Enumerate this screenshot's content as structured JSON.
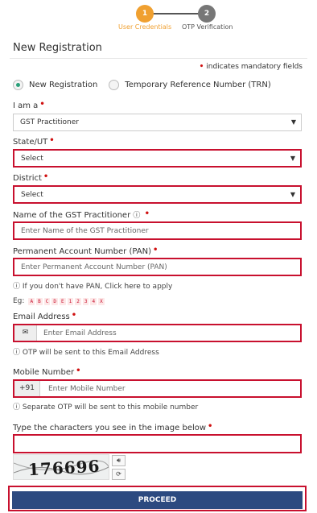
{
  "stepper": {
    "steps": [
      {
        "number": "1",
        "label": "User Credentials"
      },
      {
        "number": "2",
        "label": "OTP Verification"
      }
    ]
  },
  "page": {
    "title": "New Registration",
    "mandatory_note": "indicates mandatory fields"
  },
  "radio": {
    "options": [
      {
        "label": "New Registration",
        "selected": true
      },
      {
        "label": "Temporary Reference Number (TRN)",
        "selected": false
      }
    ]
  },
  "form": {
    "iam": {
      "label": "I am a",
      "value": "GST Practitioner"
    },
    "state": {
      "label": "State/UT",
      "value": "Select"
    },
    "district": {
      "label": "District",
      "value": "Select"
    },
    "name": {
      "label": "Name of the GST Practitioner",
      "placeholder": "Enter Name of the GST Practitioner"
    },
    "pan": {
      "label": "Permanent Account Number (PAN)",
      "placeholder": "Enter Permanent Account Number (PAN)",
      "help_prefix": "If you don't have PAN, Click",
      "help_link": "here",
      "help_suffix": "to apply",
      "example_label": "Eg:",
      "example_chars": [
        "A",
        "B",
        "C",
        "D",
        "E",
        "1",
        "2",
        "3",
        "4",
        "X"
      ]
    },
    "email": {
      "label": "Email Address",
      "placeholder": "Enter Email Address",
      "help": "OTP will be sent to this Email Address"
    },
    "mobile": {
      "label": "Mobile Number",
      "prefix": "+91",
      "placeholder": "Enter Mobile Number",
      "help": "Separate OTP will be sent to this mobile number"
    },
    "captcha": {
      "label": "Type the characters you see in the image below",
      "image_text": "176696"
    }
  },
  "actions": {
    "proceed_label": "PROCEED"
  },
  "colors": {
    "active_step": "#f0a030",
    "inactive_step": "#777777",
    "required": "#d01010",
    "error_border": "#c8102e",
    "primary_button": "#2c4a80",
    "radio_selected": "#2aa07a"
  },
  "icons": {
    "info": "info-icon",
    "email": "envelope-icon",
    "audio": "speaker-icon",
    "refresh": "refresh-icon",
    "dropdown": "caret-down-icon"
  }
}
